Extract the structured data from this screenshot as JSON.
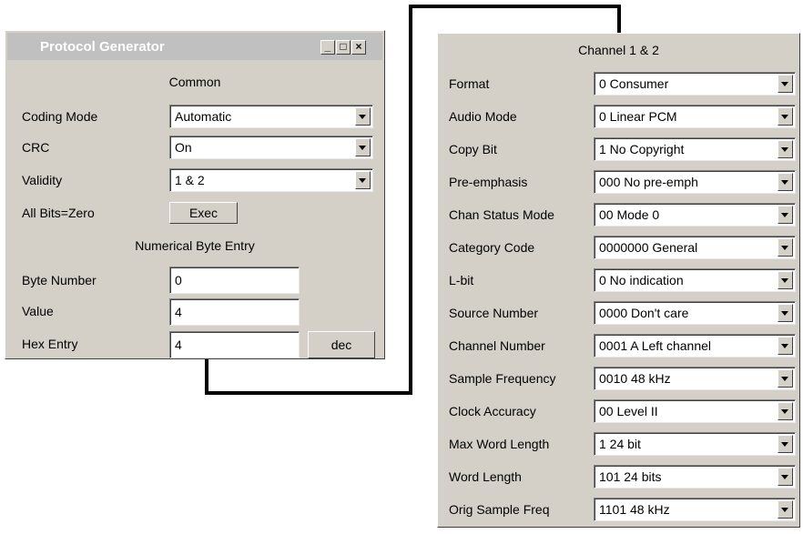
{
  "protocol_generator": {
    "title": "Protocol Generator",
    "window_buttons": {
      "minimize": "_",
      "maximize": "□",
      "close": "×"
    },
    "common": {
      "heading": "Common",
      "coding_mode": {
        "label": "Coding Mode",
        "value": "Automatic"
      },
      "crc": {
        "label": "CRC",
        "value": "On"
      },
      "validity": {
        "label": "Validity",
        "value": "1 & 2"
      },
      "all_bits_zero": {
        "label": "All Bits=Zero",
        "button": "Exec"
      }
    },
    "numerical": {
      "heading": "Numerical Byte Entry",
      "byte_number": {
        "label": "Byte Number",
        "value": "0"
      },
      "value": {
        "label": "Value",
        "value": "4"
      },
      "hex_entry": {
        "label": "Hex Entry",
        "value": "4",
        "button": "dec"
      }
    }
  },
  "channel_panel": {
    "heading": "Channel 1 & 2",
    "rows": [
      {
        "label": "Format",
        "value": "0  Consumer"
      },
      {
        "label": "Audio Mode",
        "value": "0  Linear PCM"
      },
      {
        "label": "Copy Bit",
        "value": "1  No Copyright"
      },
      {
        "label": "Pre-emphasis",
        "value": "000  No pre-emph"
      },
      {
        "label": "Chan Status Mode",
        "value": "00  Mode 0"
      },
      {
        "label": "Category Code",
        "value": "0000000  General"
      },
      {
        "label": "L-bit",
        "value": "0  No indication"
      },
      {
        "label": "Source Number",
        "value": "0000  Don't care"
      },
      {
        "label": "Channel Number",
        "value": "0001  A Left channel"
      },
      {
        "label": "Sample Frequency",
        "value": "0010  48 kHz"
      },
      {
        "label": "Clock Accuracy",
        "value": "00  Level II"
      },
      {
        "label": "Max Word Length",
        "value": "1  24 bit"
      },
      {
        "label": "Word Length",
        "value": "101  24 bits"
      },
      {
        "label": "Orig Sample Freq",
        "value": "1101  48 kHz"
      }
    ]
  }
}
